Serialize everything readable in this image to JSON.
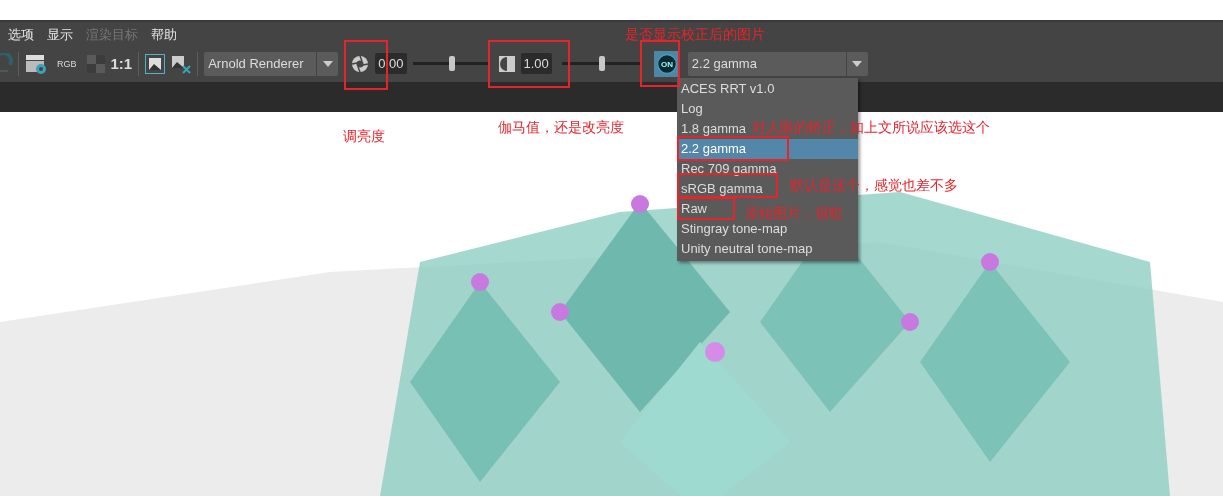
{
  "menu_bar": {
    "items": [
      {
        "label": "选项",
        "disabled": false
      },
      {
        "label": "显示",
        "disabled": false
      },
      {
        "label": "渲染目标",
        "disabled": true
      },
      {
        "label": "帮助",
        "disabled": false
      }
    ]
  },
  "toolbar": {
    "channel_label": "RGB",
    "ratio_label": "1:1",
    "renderer": "Arnold Renderer",
    "exposure": {
      "value": "0.00",
      "level": 0.52
    },
    "gamma": {
      "value": "1.00",
      "level": 0.5
    },
    "view_transform": {
      "on": true,
      "on_label": "ON",
      "value": "2.2 gamma"
    }
  },
  "dropdown": {
    "options": [
      {
        "label": "ACES RRT v1.0",
        "selected": false
      },
      {
        "label": "Log",
        "selected": false
      },
      {
        "label": "1.8 gamma",
        "selected": false
      },
      {
        "label": "2.2 gamma",
        "selected": true
      },
      {
        "label": "Rec 709 gamma",
        "selected": false
      },
      {
        "label": "sRGB gamma",
        "selected": false
      },
      {
        "label": "Raw",
        "selected": false
      },
      {
        "label": "Stingray tone-map",
        "selected": false
      },
      {
        "label": "Unity neutral tone-map",
        "selected": false
      }
    ]
  },
  "annotations": [
    {
      "text": "是否显示校正后的图片"
    },
    {
      "text": "调亮度"
    },
    {
      "text": "伽马值，还是改亮度"
    },
    {
      "text": "对人眼的矫正，如上文所说应该选这个"
    },
    {
      "text": "默认是这个，感觉也差不多"
    },
    {
      "text": "原始图片，很暗"
    }
  ]
}
